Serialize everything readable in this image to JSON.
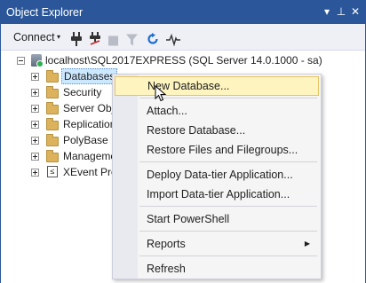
{
  "window": {
    "title": "Object Explorer",
    "pin_glyph": "▾",
    "autohide_glyph": "⊥",
    "close_glyph": "✕"
  },
  "toolbar": {
    "connect_label": "Connect",
    "connect_arrow": "▾"
  },
  "tree": {
    "server": "localhost\\SQL2017EXPRESS (SQL Server 14.0.1000 - sa)",
    "items": [
      {
        "label": "Databases",
        "icon": "folder-icon"
      },
      {
        "label": "Security",
        "icon": "folder-icon"
      },
      {
        "label": "Server Obje",
        "icon": "folder-icon"
      },
      {
        "label": "Replication",
        "icon": "folder-icon"
      },
      {
        "label": "PolyBase",
        "icon": "folder-icon"
      },
      {
        "label": "Manageme",
        "icon": "folder-icon"
      },
      {
        "label": "XEvent Pro",
        "icon": "xevent-icon"
      }
    ]
  },
  "context_menu": {
    "items": [
      {
        "label": "New Database..."
      },
      {
        "label": "Attach..."
      },
      {
        "label": "Restore Database..."
      },
      {
        "label": "Restore Files and Filegroups..."
      },
      {
        "label": "Deploy Data-tier Application..."
      },
      {
        "label": "Import Data-tier Application..."
      },
      {
        "label": "Start PowerShell"
      },
      {
        "label": "Reports",
        "submenu_arrow": "▶"
      },
      {
        "label": "Refresh"
      }
    ]
  },
  "colors": {
    "titlebar": "#2b579a",
    "menu_hover": "#fdf4bf",
    "selection": "#cce8ff"
  }
}
